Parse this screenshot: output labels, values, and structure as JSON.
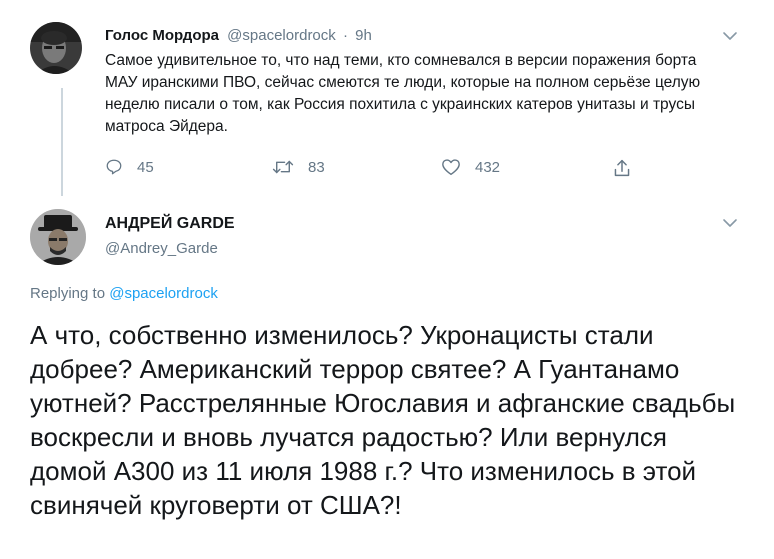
{
  "tweet1": {
    "author_name": "Голос Мордора",
    "handle": "@spacelordrock",
    "separator": "·",
    "time": "9h",
    "avatar_icon": "user-avatar",
    "text": "Самое удивительное то, что над теми, кто сомневался в версии поражения борта МАУ иранскими ПВО, сейчас смеются те люди, которые на полном серьёзе целую неделю писали о том, как Россия похитила с украинских катеров унитазы и трусы матроса Эйдера.",
    "actions": {
      "reply_count": "45",
      "retweet_count": "83",
      "like_count": "432",
      "reply_icon": "reply-icon",
      "retweet_icon": "retweet-icon",
      "like_icon": "heart-icon",
      "share_icon": "share-icon"
    }
  },
  "tweet2": {
    "author_name": "АНДРЕЙ GARDE",
    "handle": "@Andrey_Garde",
    "avatar_icon": "user-avatar",
    "replying_prefix": "Replying to",
    "replying_to": "@spacelordrock",
    "text": "А что, собственно изменилось? Укронацисты стали добрее? Американский террор святее? А Гуантанамо уютней? Расстрелянные Югославия и афганские свадьбы воскресли и вновь лучатся радостью? Или вернулся домой А300 из 11 июля 1988 г.? Что изменилось в этой свинячей круговерти от США?!"
  },
  "colors": {
    "text": "#14171a",
    "muted": "#657786",
    "link": "#1da1f2",
    "thread_line": "#ccd6dd"
  }
}
